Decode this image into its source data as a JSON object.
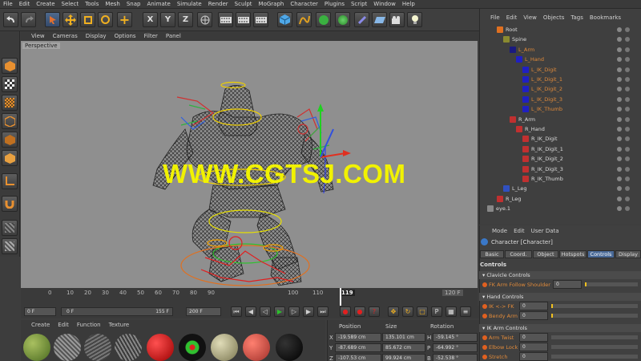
{
  "menubar": [
    "File",
    "Edit",
    "Create",
    "Select",
    "Tools",
    "Mesh",
    "Snap",
    "Animate",
    "Simulate",
    "Render",
    "Sculpt",
    "MoGraph",
    "Character",
    "Plugins",
    "Script",
    "Window",
    "Help"
  ],
  "viewport": {
    "menu": [
      "View",
      "Cameras",
      "Display",
      "Options",
      "Filter",
      "Panel"
    ],
    "label": "Perspective",
    "watermark": "WWW.CGTSJ.COM"
  },
  "timeline": {
    "ticks": [
      "0",
      "10",
      "20",
      "30",
      "40",
      "50",
      "60",
      "70",
      "80",
      "90",
      "100",
      "110",
      "119",
      "120 F"
    ],
    "current": "119"
  },
  "playbar": {
    "start": "0 F",
    "left_field": "0 F",
    "mid_field": "155 F",
    "end": "200 F"
  },
  "materials": {
    "menu": [
      "Create",
      "Edit",
      "Function",
      "Texture"
    ]
  },
  "coords": {
    "headers": [
      "Position",
      "Size",
      "Rotation"
    ],
    "rows": [
      {
        "axis": "X",
        "pos": "-19.589 cm",
        "size": "135.101 cm",
        "rot_axis": "H",
        "rot": "-59.145 °"
      },
      {
        "axis": "Y",
        "pos": "-87.689 cm",
        "size": "85.672 cm",
        "rot_axis": "P",
        "rot": "-64.992 °"
      },
      {
        "axis": "Z",
        "pos": "-107.53 cm",
        "size": "99.924 cm",
        "rot_axis": "B",
        "rot": "-52.538 °"
      }
    ]
  },
  "objects": {
    "menu": [
      "File",
      "Edit",
      "View",
      "Objects",
      "Tags",
      "Bookmarks"
    ],
    "items": [
      {
        "name": "Root",
        "highlight": false
      },
      {
        "name": "Spine",
        "highlight": false
      },
      {
        "name": "L_Arm",
        "highlight": true
      },
      {
        "name": "L_Hand",
        "highlight": true
      },
      {
        "name": "L_IK_Digit",
        "highlight": true
      },
      {
        "name": "L_IK_Digit_1",
        "highlight": true
      },
      {
        "name": "L_IK_Digit_2",
        "highlight": true
      },
      {
        "name": "L_IK_Digit_3",
        "highlight": true
      },
      {
        "name": "L_IK_Thumb",
        "highlight": true
      },
      {
        "name": "R_Arm",
        "highlight": false
      },
      {
        "name": "R_Hand",
        "highlight": false
      },
      {
        "name": "R_IK_Digit",
        "highlight": false
      },
      {
        "name": "R_IK_Digit_1",
        "highlight": false
      },
      {
        "name": "R_IK_Digit_2",
        "highlight": false
      },
      {
        "name": "R_IK_Digit_3",
        "highlight": false
      },
      {
        "name": "R_IK_Thumb",
        "highlight": false
      },
      {
        "name": "L_Leg",
        "highlight": false
      },
      {
        "name": "R_Leg",
        "highlight": false
      },
      {
        "name": "eye.1",
        "highlight": false
      }
    ]
  },
  "attributes": {
    "menu": [
      "Mode",
      "Edit",
      "User Data"
    ],
    "object": "Character [Character]",
    "tabs": [
      "Basic",
      "Coord.",
      "Object",
      "Hotspots",
      "Controls",
      "Display"
    ],
    "active_tab": "Controls",
    "heading": "Controls",
    "sections": [
      {
        "title": "Clavicle Controls",
        "props": [
          {
            "label": "FK Arm Follow Shoulder",
            "value": "0"
          }
        ]
      },
      {
        "title": "Hand Controls",
        "props": [
          {
            "label": "IK <-> FK",
            "value": "0"
          },
          {
            "label": "Bendy Arm",
            "value": "0"
          }
        ]
      },
      {
        "title": "IK Arm Controls",
        "props": [
          {
            "label": "Arm Twist",
            "value": "0"
          },
          {
            "label": "Elbow Lock",
            "value": "0"
          },
          {
            "label": "Stretch",
            "value": "0"
          }
        ]
      }
    ]
  },
  "colors": {
    "accent": "#e08a3a",
    "selection": "#4a6a98",
    "watermark": "#f1f200"
  }
}
